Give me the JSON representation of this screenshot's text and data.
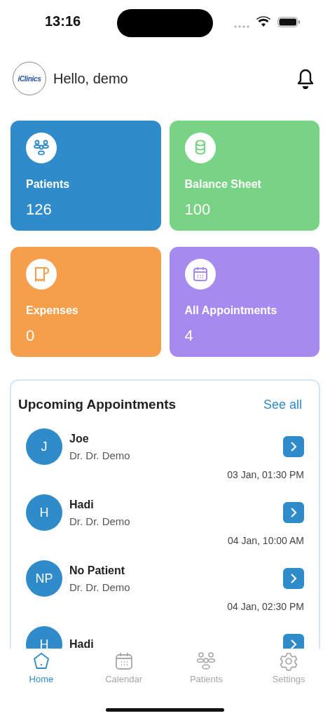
{
  "status_bar": {
    "time": "13:16"
  },
  "header": {
    "logo_text": "iClinics",
    "greeting": "Hello, demo"
  },
  "stats": [
    {
      "kind": "patients",
      "label": "Patients",
      "value": "126",
      "color": "#2f8bc9"
    },
    {
      "kind": "balance",
      "label": "Balance Sheet",
      "value": "100",
      "color": "#79d384"
    },
    {
      "kind": "expenses",
      "label": "Expenses",
      "value": "0",
      "color": "#f59f4c"
    },
    {
      "kind": "appointments",
      "label": "All Appointments",
      "value": "4",
      "color": "#a78af0"
    }
  ],
  "upcoming": {
    "title": "Upcoming Appointments",
    "see_all": "See all",
    "items": [
      {
        "initials": "J",
        "name": "Joe",
        "doctor": "Dr. Dr. Demo",
        "time": "03 Jan, 01:30 PM"
      },
      {
        "initials": "H",
        "name": "Hadi",
        "doctor": "Dr. Dr. Demo",
        "time": "04 Jan, 10:00 AM"
      },
      {
        "initials": "NP",
        "name": "No Patient",
        "doctor": "Dr. Dr. Demo",
        "time": "04 Jan, 02:30 PM"
      },
      {
        "initials": "H",
        "name": "Hadi"
      }
    ]
  },
  "tabs": [
    {
      "kind": "home",
      "label": "Home",
      "selected": true
    },
    {
      "kind": "calendar",
      "label": "Calendar",
      "selected": false
    },
    {
      "kind": "patients",
      "label": "Patients",
      "selected": false
    },
    {
      "kind": "settings",
      "label": "Settings",
      "selected": false
    }
  ]
}
